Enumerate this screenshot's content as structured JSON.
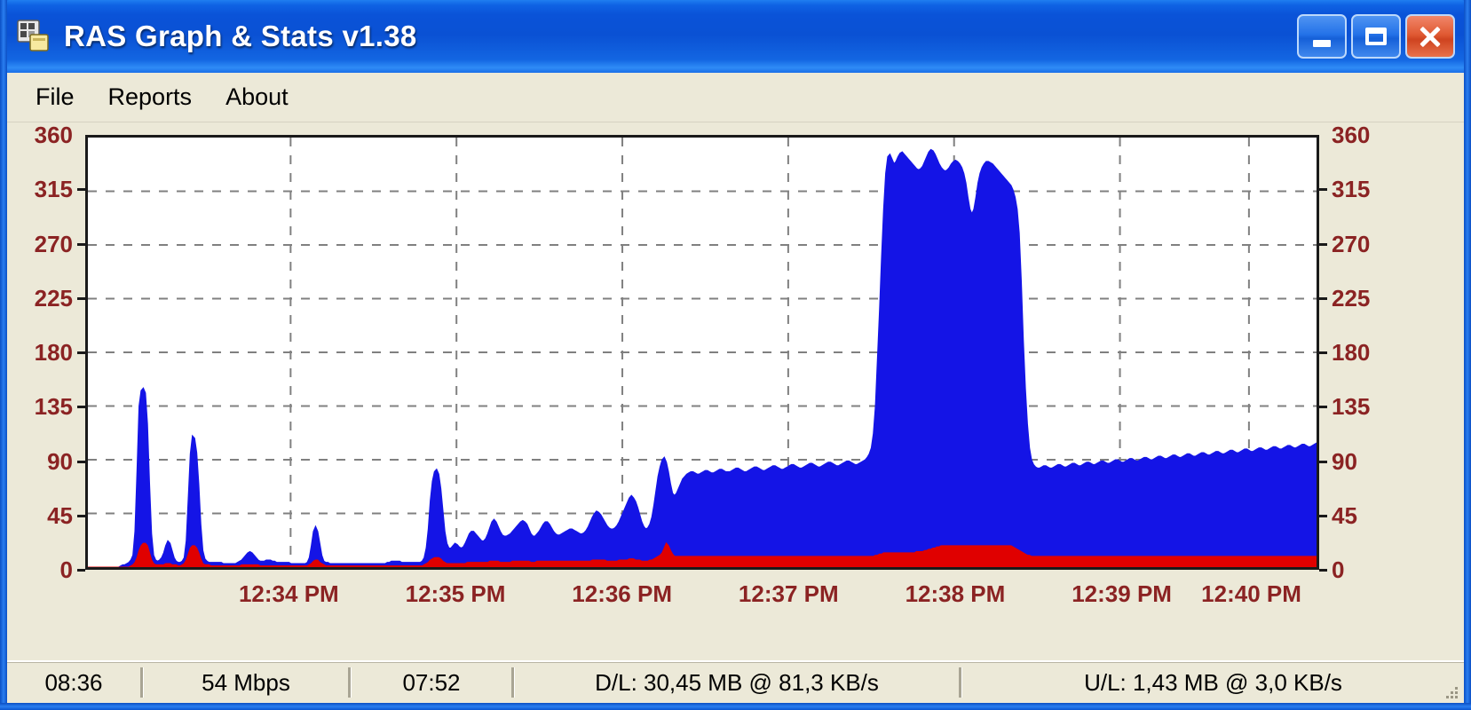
{
  "window": {
    "title": "RAS Graph & Stats v1.38",
    "icon": "network-connections-icon",
    "controls": {
      "minimize": "Minimize",
      "maximize": "Maximize",
      "close": "Close"
    }
  },
  "menu": {
    "items": [
      {
        "label": "File"
      },
      {
        "label": "Reports"
      },
      {
        "label": "About"
      }
    ]
  },
  "statusbar": {
    "connected_time": "08:36",
    "link_speed": "54 Mbps",
    "session_time": "07:52",
    "download": "D/L: 30,45 MB @ 81,3 KB/s",
    "upload": "U/L: 1,43 MB @ 3,0 KB/s"
  },
  "colors": {
    "download_series": "#1414e6",
    "upload_series": "#e00000",
    "axis_text": "#8b2323",
    "plot_background": "#ffffff",
    "grid": "#808080",
    "window_face": "#ece9d8",
    "title_bar": "#0a53d8",
    "close_button": "#cf4420"
  },
  "chart_data": {
    "type": "area",
    "title": "RAS bandwidth monitor",
    "xlabel": "",
    "ylabel": "",
    "ylim": [
      0,
      360
    ],
    "yticks": [
      0,
      45,
      90,
      135,
      180,
      225,
      270,
      315,
      360
    ],
    "ytick_labels": [
      "0",
      "45",
      "90",
      "135",
      "180",
      "225",
      "270",
      "315",
      "360"
    ],
    "y_axis_left_labels": [
      "360",
      "315",
      "270",
      "225",
      "180",
      "135",
      "90",
      "45",
      "0"
    ],
    "y_axis_right_labels": [
      "360",
      "315",
      "270",
      "225",
      "180",
      "135",
      "90",
      "45",
      "0"
    ],
    "x_tick_labels": [
      "12:34 PM",
      "12:35 PM",
      "12:36 PM",
      "12:37 PM",
      "12:38 PM",
      "12:39 PM",
      "12:40 PM"
    ],
    "x_tick_positions": [
      0.165,
      0.3,
      0.435,
      0.57,
      0.705,
      0.84,
      0.945
    ],
    "grid": true,
    "grid_style": "dashed",
    "units": "KB/s",
    "legend": [],
    "series": [
      {
        "name": "Download",
        "color": "#1414e6",
        "values": [
          0,
          0,
          0,
          0,
          0,
          0,
          0,
          0,
          0,
          0,
          0,
          0,
          0,
          0,
          0,
          0,
          1,
          2,
          2,
          3,
          4,
          6,
          10,
          30,
          80,
          135,
          148,
          150,
          146,
          120,
          70,
          28,
          10,
          6,
          5,
          6,
          8,
          12,
          18,
          22,
          20,
          14,
          8,
          5,
          4,
          4,
          5,
          8,
          22,
          58,
          95,
          110,
          108,
          96,
          70,
          36,
          14,
          7,
          5,
          4,
          4,
          4,
          4,
          4,
          4,
          4,
          3,
          3,
          3,
          3,
          3,
          3,
          3,
          4,
          5,
          6,
          8,
          10,
          12,
          13,
          12,
          10,
          8,
          6,
          5,
          5,
          5,
          6,
          6,
          6,
          5,
          5,
          4,
          4,
          4,
          4,
          4,
          4,
          4,
          3,
          3,
          3,
          3,
          3,
          3,
          3,
          3,
          4,
          8,
          18,
          30,
          34,
          30,
          20,
          10,
          5,
          4,
          4,
          3,
          3,
          3,
          3,
          3,
          3,
          3,
          3,
          3,
          3,
          3,
          3,
          3,
          3,
          3,
          3,
          3,
          3,
          3,
          3,
          3,
          3,
          3,
          3,
          3,
          3,
          3,
          3,
          4,
          4,
          5,
          5,
          5,
          5,
          5,
          4,
          4,
          4,
          4,
          4,
          4,
          4,
          4,
          4,
          4,
          5,
          8,
          16,
          32,
          56,
          72,
          80,
          82,
          78,
          66,
          48,
          30,
          20,
          16,
          16,
          18,
          20,
          19,
          17,
          16,
          17,
          20,
          24,
          28,
          30,
          30,
          28,
          26,
          24,
          22,
          22,
          24,
          28,
          33,
          38,
          40,
          38,
          34,
          30,
          27,
          26,
          26,
          27,
          28,
          30,
          32,
          34,
          36,
          38,
          39,
          38,
          36,
          32,
          28,
          26,
          26,
          28,
          30,
          33,
          36,
          38,
          38,
          36,
          33,
          30,
          28,
          27,
          27,
          28,
          29,
          30,
          31,
          32,
          32,
          31,
          30,
          29,
          28,
          28,
          29,
          31,
          34,
          38,
          42,
          45,
          47,
          46,
          44,
          41,
          38,
          35,
          33,
          32,
          32,
          33,
          35,
          38,
          42,
          46,
          50,
          54,
          58,
          60,
          58,
          55,
          50,
          44,
          38,
          34,
          32,
          33,
          36,
          42,
          52,
          64,
          76,
          84,
          90,
          92,
          88,
          80,
          70,
          62,
          60,
          62,
          66,
          70,
          74,
          76,
          78,
          79,
          80,
          80,
          79,
          78,
          78,
          79,
          80,
          81,
          81,
          80,
          79,
          79,
          80,
          81,
          82,
          82,
          81,
          80,
          80,
          80,
          81,
          82,
          83,
          83,
          82,
          81,
          80,
          80,
          81,
          82,
          83,
          84,
          84,
          83,
          82,
          81,
          81,
          82,
          83,
          84,
          85,
          85,
          84,
          83,
          82,
          82,
          83,
          84,
          85,
          86,
          86,
          85,
          84,
          83,
          83,
          84,
          85,
          86,
          87,
          87,
          86,
          85,
          84,
          84,
          85,
          86,
          87,
          88,
          88,
          87,
          86,
          85,
          85,
          86,
          87,
          88,
          89,
          89,
          88,
          87,
          86,
          86,
          87,
          88,
          89,
          90,
          92,
          95,
          100,
          112,
          135,
          175,
          215,
          260,
          300,
          330,
          344,
          346,
          342,
          338,
          340,
          344,
          347,
          348,
          346,
          344,
          342,
          340,
          338,
          336,
          334,
          333,
          334,
          336,
          340,
          344,
          348,
          350,
          349,
          346,
          342,
          338,
          335,
          333,
          332,
          333,
          335,
          338,
          340,
          341,
          340,
          338,
          335,
          330,
          322,
          310,
          300,
          296,
          300,
          310,
          322,
          330,
          335,
          338,
          340,
          340,
          339,
          338,
          336,
          334,
          332,
          330,
          328,
          326,
          324,
          322,
          320,
          316,
          310,
          300,
          280,
          240,
          190,
          150,
          120,
          100,
          90,
          86,
          84,
          83,
          83,
          84,
          85,
          85,
          84,
          83,
          83,
          84,
          85,
          86,
          86,
          85,
          84,
          84,
          85,
          86,
          87,
          87,
          86,
          85,
          85,
          86,
          87,
          88,
          88,
          87,
          86,
          86,
          87,
          88,
          89,
          89,
          88,
          87,
          87,
          88,
          89,
          90,
          90,
          89,
          88,
          88,
          89,
          90,
          91,
          91,
          90,
          89,
          89,
          90,
          91,
          92,
          92,
          91,
          90,
          90,
          91,
          92,
          93,
          93,
          92,
          91,
          91,
          92,
          93,
          94,
          94,
          93,
          92,
          92,
          93,
          94,
          95,
          95,
          94,
          93,
          93,
          94,
          95,
          96,
          96,
          95,
          94,
          94,
          95,
          96,
          97,
          97,
          96,
          95,
          95,
          96,
          97,
          98,
          98,
          97,
          96,
          96,
          97,
          98,
          99,
          99,
          98,
          97,
          97,
          98,
          99,
          100,
          100,
          99,
          98,
          98,
          99,
          100,
          101,
          101,
          100,
          99,
          99,
          100,
          101,
          102,
          102,
          101,
          100,
          100,
          101,
          102,
          103,
          103,
          102,
          101,
          101,
          102,
          103,
          104
        ]
      },
      {
        "name": "Upload",
        "color": "#e00000",
        "values": [
          0,
          0,
          0,
          0,
          0,
          0,
          0,
          0,
          0,
          0,
          0,
          0,
          0,
          0,
          0,
          0,
          0,
          0,
          0,
          0,
          0,
          1,
          2,
          4,
          8,
          14,
          18,
          20,
          20,
          18,
          12,
          6,
          3,
          2,
          2,
          2,
          2,
          2,
          3,
          3,
          3,
          2,
          2,
          2,
          1,
          1,
          2,
          3,
          6,
          11,
          16,
          18,
          18,
          16,
          12,
          7,
          3,
          2,
          2,
          2,
          1,
          1,
          1,
          1,
          1,
          1,
          1,
          1,
          1,
          1,
          1,
          1,
          1,
          1,
          1,
          2,
          2,
          2,
          2,
          2,
          2,
          2,
          2,
          2,
          1,
          1,
          1,
          1,
          1,
          1,
          1,
          1,
          1,
          1,
          1,
          1,
          1,
          1,
          1,
          1,
          1,
          1,
          1,
          1,
          1,
          1,
          1,
          1,
          2,
          3,
          5,
          6,
          6,
          4,
          3,
          2,
          1,
          1,
          1,
          1,
          1,
          1,
          1,
          1,
          1,
          1,
          1,
          1,
          1,
          1,
          1,
          1,
          1,
          1,
          1,
          1,
          1,
          1,
          1,
          1,
          1,
          1,
          1,
          1,
          1,
          1,
          1,
          1,
          1,
          1,
          1,
          1,
          1,
          1,
          1,
          1,
          1,
          1,
          1,
          1,
          1,
          1,
          1,
          1,
          2,
          3,
          4,
          6,
          7,
          8,
          8,
          8,
          7,
          5,
          4,
          3,
          3,
          3,
          3,
          3,
          3,
          3,
          3,
          3,
          3,
          4,
          4,
          4,
          4,
          4,
          4,
          4,
          4,
          4,
          4,
          4,
          5,
          5,
          5,
          5,
          5,
          4,
          4,
          4,
          4,
          4,
          4,
          5,
          5,
          5,
          5,
          5,
          5,
          5,
          5,
          5,
          4,
          4,
          4,
          5,
          5,
          5,
          5,
          5,
          5,
          5,
          5,
          5,
          5,
          5,
          5,
          5,
          5,
          5,
          5,
          5,
          5,
          5,
          5,
          5,
          5,
          5,
          5,
          5,
          5,
          5,
          6,
          6,
          6,
          6,
          6,
          6,
          6,
          5,
          5,
          5,
          5,
          5,
          5,
          6,
          6,
          6,
          6,
          6,
          7,
          7,
          7,
          6,
          6,
          6,
          5,
          5,
          5,
          5,
          6,
          6,
          7,
          8,
          9,
          10,
          12,
          16,
          20,
          18,
          14,
          11,
          9,
          9,
          9,
          9,
          9,
          9,
          9,
          9,
          9,
          9,
          9,
          9,
          9,
          9,
          9,
          9,
          9,
          9,
          9,
          9,
          9,
          9,
          9,
          9,
          9,
          9,
          9,
          9,
          9,
          9,
          9,
          9,
          9,
          9,
          9,
          9,
          9,
          9,
          9,
          9,
          9,
          9,
          9,
          9,
          9,
          9,
          9,
          9,
          9,
          9,
          9,
          9,
          9,
          9,
          9,
          9,
          9,
          9,
          9,
          9,
          9,
          9,
          9,
          9,
          9,
          9,
          9,
          9,
          9,
          9,
          9,
          9,
          9,
          9,
          9,
          9,
          9,
          9,
          9,
          9,
          9,
          9,
          9,
          9,
          9,
          9,
          9,
          9,
          9,
          9,
          9,
          9,
          9,
          9,
          9,
          9,
          9,
          9,
          10,
          10,
          11,
          11,
          12,
          12,
          12,
          12,
          12,
          12,
          12,
          12,
          12,
          12,
          12,
          12,
          12,
          12,
          12,
          12,
          13,
          13,
          13,
          13,
          14,
          14,
          15,
          15,
          16,
          16,
          17,
          17,
          18,
          18,
          18,
          18,
          18,
          18,
          18,
          18,
          18,
          18,
          18,
          18,
          18,
          18,
          18,
          18,
          18,
          18,
          18,
          18,
          18,
          18,
          18,
          18,
          18,
          18,
          18,
          18,
          18,
          18,
          18,
          18,
          18,
          18,
          18,
          17,
          16,
          15,
          14,
          13,
          12,
          11,
          10,
          10,
          9,
          9,
          9,
          9,
          9,
          9,
          9,
          9,
          9,
          9,
          9,
          9,
          9,
          9,
          9,
          9,
          9,
          9,
          9,
          9,
          9,
          9,
          9,
          9,
          9,
          9,
          9,
          9,
          9,
          9,
          9,
          9,
          9,
          9,
          9,
          9,
          9,
          9,
          9,
          9,
          9,
          9,
          9,
          9,
          9,
          9,
          9,
          9,
          9,
          9,
          9,
          9,
          9,
          9,
          9,
          9,
          9,
          9,
          9,
          9,
          9,
          9,
          9,
          9,
          9,
          9,
          9,
          9,
          9,
          9,
          9,
          9,
          9,
          9,
          9,
          9,
          9,
          9,
          9,
          9,
          9,
          9,
          9,
          9,
          9,
          9,
          9,
          9,
          9,
          9,
          9,
          9,
          9,
          9,
          9,
          9,
          9,
          9,
          9,
          9,
          9,
          9,
          9,
          9,
          9,
          9,
          9,
          9,
          9,
          9,
          9,
          9,
          9,
          9,
          9,
          9,
          9,
          9,
          9,
          9,
          9,
          9,
          9,
          9,
          9,
          9,
          9,
          9,
          9,
          9,
          9,
          9,
          9,
          9,
          9,
          9,
          9,
          9,
          9,
          9
        ]
      }
    ]
  }
}
